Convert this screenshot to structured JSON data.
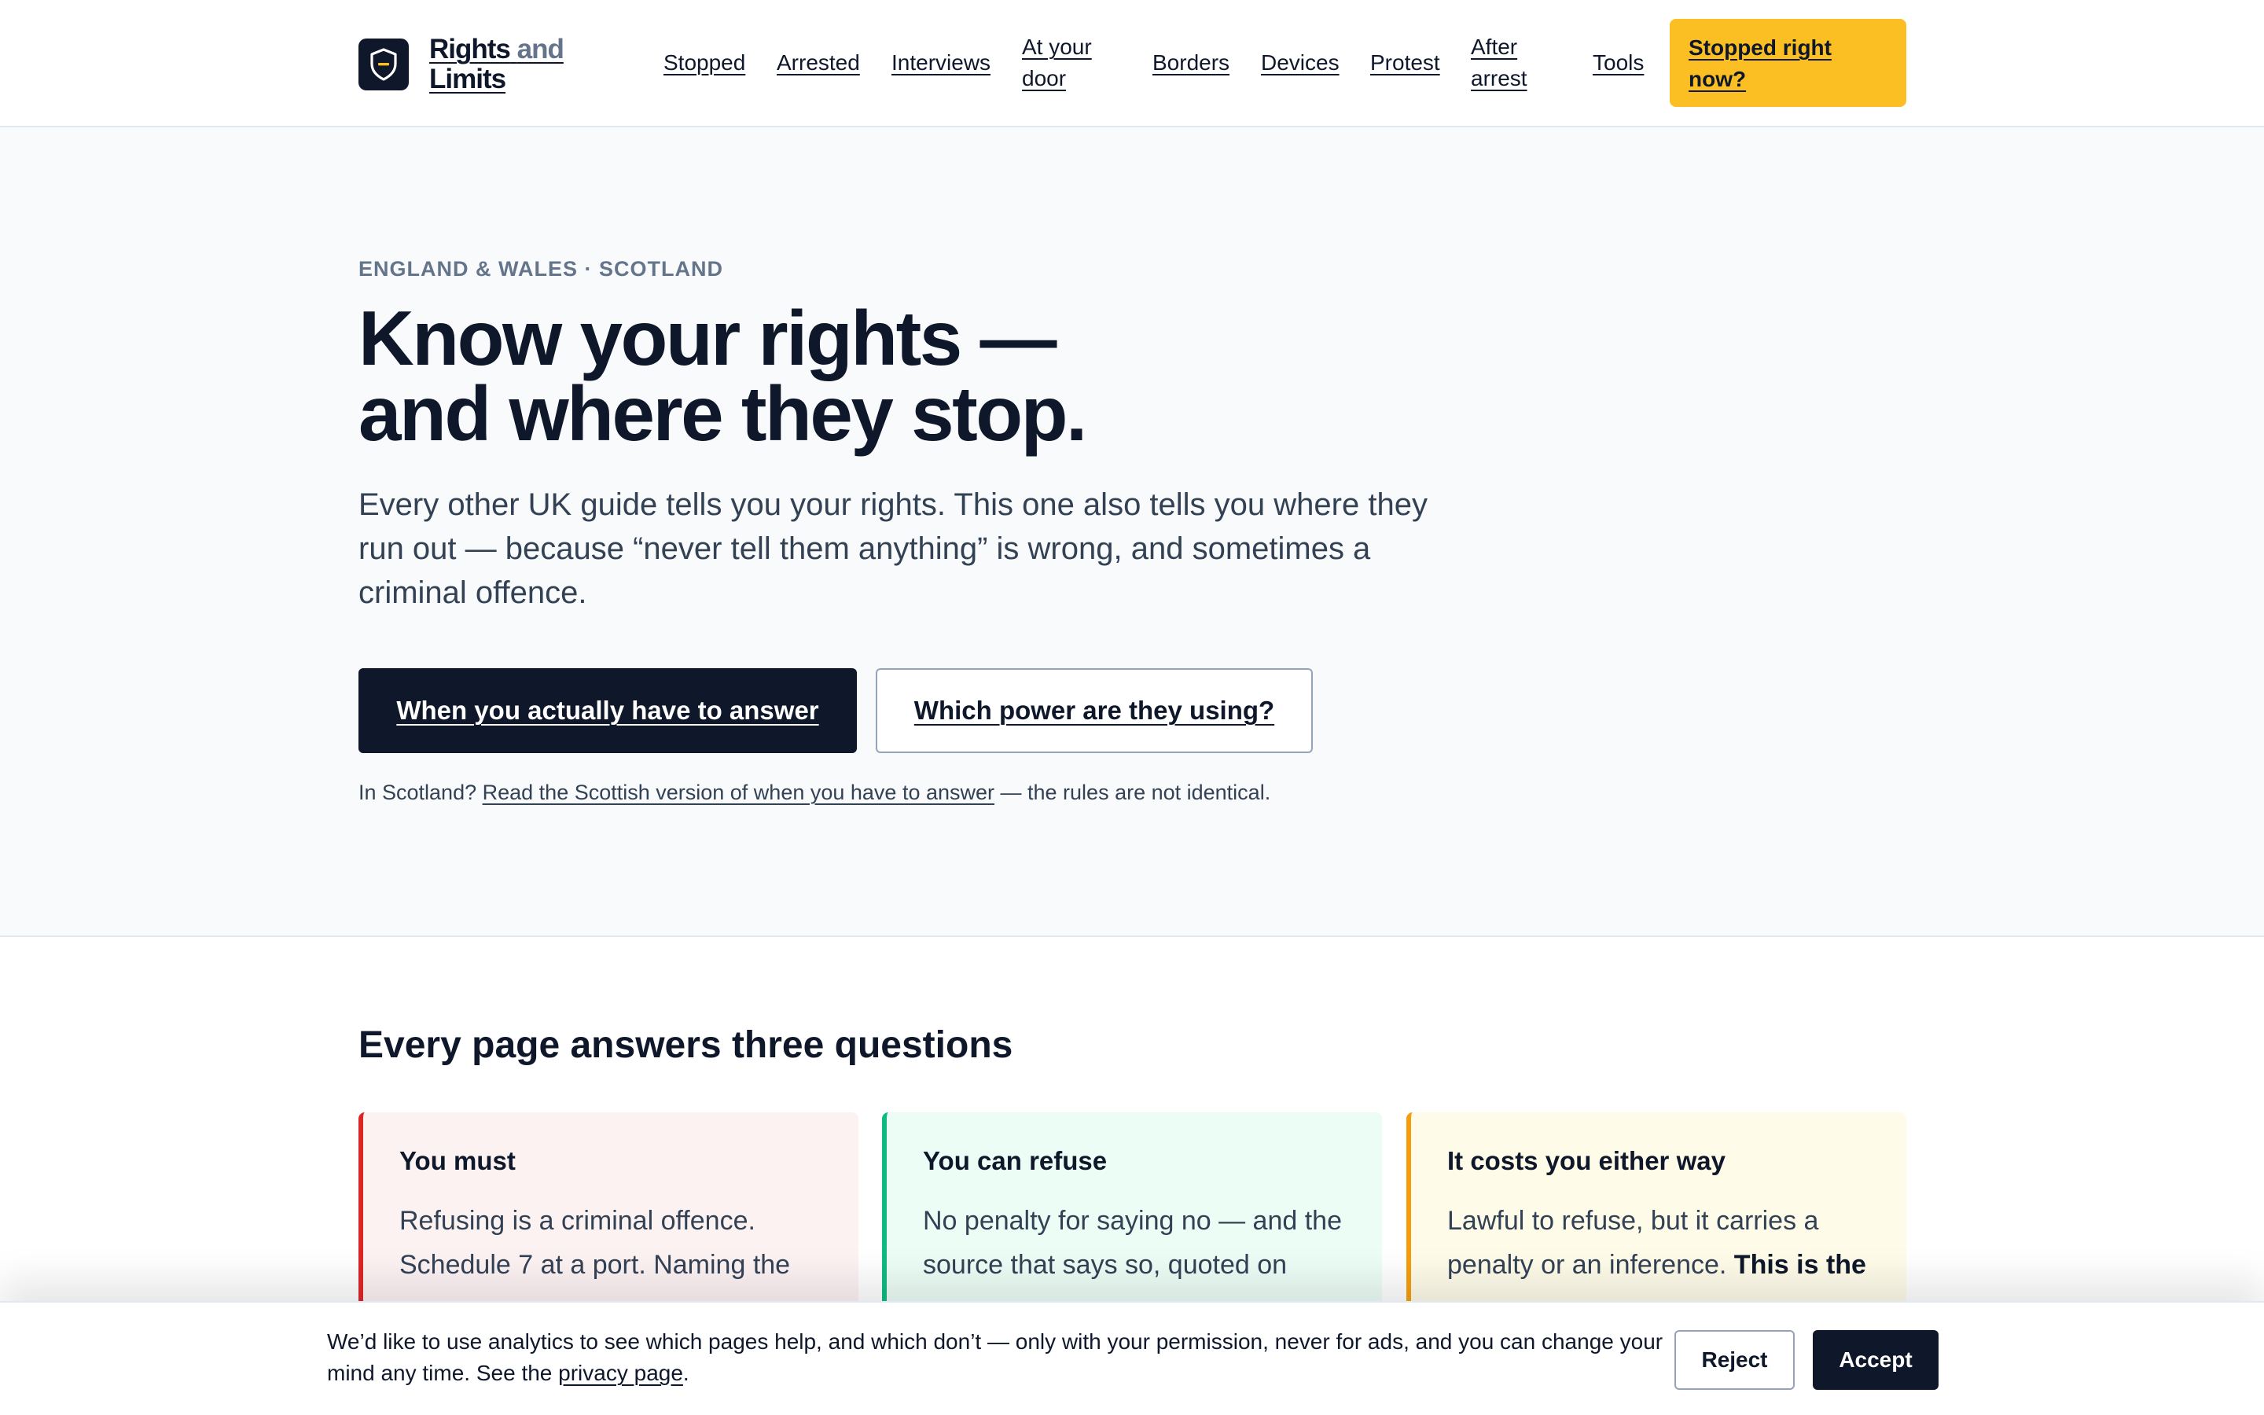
{
  "header": {
    "brand": {
      "part_a": "Rights",
      "part_b": "and",
      "part_c": "Limits",
      "icon": "shield-icon"
    },
    "nav": [
      {
        "label": "Stopped"
      },
      {
        "label": "Arrested"
      },
      {
        "label": "Interviews"
      },
      {
        "line1": "At your",
        "line2": "door"
      },
      {
        "label": "Borders"
      },
      {
        "label": "Devices"
      },
      {
        "label": "Protest"
      },
      {
        "line1": "After",
        "line2": "arrest"
      },
      {
        "label": "Tools"
      }
    ],
    "cta": {
      "line1": "Stopped right",
      "line2": "now?"
    }
  },
  "hero": {
    "kicker": "ENGLAND & WALES · SCOTLAND",
    "title_line1": "Know your rights —",
    "title_line2": "and where they stop.",
    "lead": "Every other UK guide tells you your rights. This one also tells you where they run out — because “never tell them anything” is wrong, and sometimes a criminal offence.",
    "primary_button": "When you actually have to answer",
    "secondary_button": "Which power are they using?",
    "note_before": "In Scotland?",
    "note_link": "Read the Scottish version of when you have to answer",
    "note_after": "— the rules are not identical."
  },
  "questions": {
    "title": "Every page answers three questions",
    "cards": [
      {
        "title": "You must",
        "body": "Refusing is a criminal offence. Schedule 7 at a port. Naming the"
      },
      {
        "title": "You can refuse",
        "body": "No penalty for saying no — and the source that says so, quoted on"
      },
      {
        "title": "It costs you either way",
        "body": "Lawful to refuse, but it carries a penalty or an inference.",
        "body_strong": "This is the"
      }
    ]
  },
  "cookie": {
    "text": "We’d like to use analytics to see which pages help, and which don’t — only with your permission, never for ads, and you can change your mind any time. See the",
    "link": "privacy page",
    "text_end": ".",
    "reject_label": "Reject",
    "accept_label": "Accept"
  },
  "colors": {
    "ink": "#0f172a",
    "muted": "#64748b",
    "cta_yellow": "#fbbf24",
    "must_red": "#dc2626",
    "refuse_green": "#10b981",
    "costs_amber": "#f59e0b"
  }
}
